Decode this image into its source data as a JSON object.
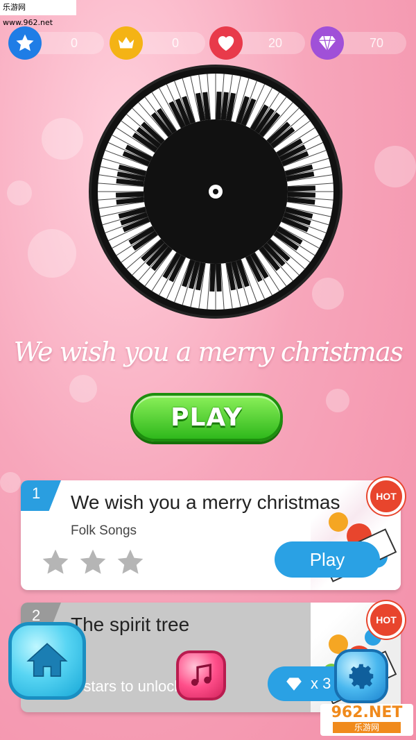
{
  "watermark_top": "乐游网 www.962.net",
  "stats": [
    {
      "icon": "star-icon",
      "value": "0",
      "color": "#1f7de6"
    },
    {
      "icon": "crown-icon",
      "value": "0",
      "color": "#f4b315"
    },
    {
      "icon": "heart-icon",
      "value": "20",
      "color": "#e83a4a"
    },
    {
      "icon": "diamond-icon",
      "value": "70",
      "color": "#a050d8"
    }
  ],
  "now_playing": {
    "title": "We wish you a merry christmas",
    "play_label": "PLAY"
  },
  "songs": [
    {
      "number": "1",
      "title": "We wish you a merry christmas",
      "genre": "Folk Songs",
      "badge": "HOT",
      "button": "Play",
      "stars_earned": 0,
      "stars_total": 3
    },
    {
      "number": "2",
      "title": "The spirit tree",
      "badge": "HOT",
      "unlock_text": "e stars to unlock",
      "cost": "x 3"
    }
  ],
  "bottom_nav": [
    "home-icon",
    "music-note-icon",
    "gear-icon"
  ],
  "watermark_bottom": {
    "logo": "962.NET",
    "sub": "乐游网"
  }
}
